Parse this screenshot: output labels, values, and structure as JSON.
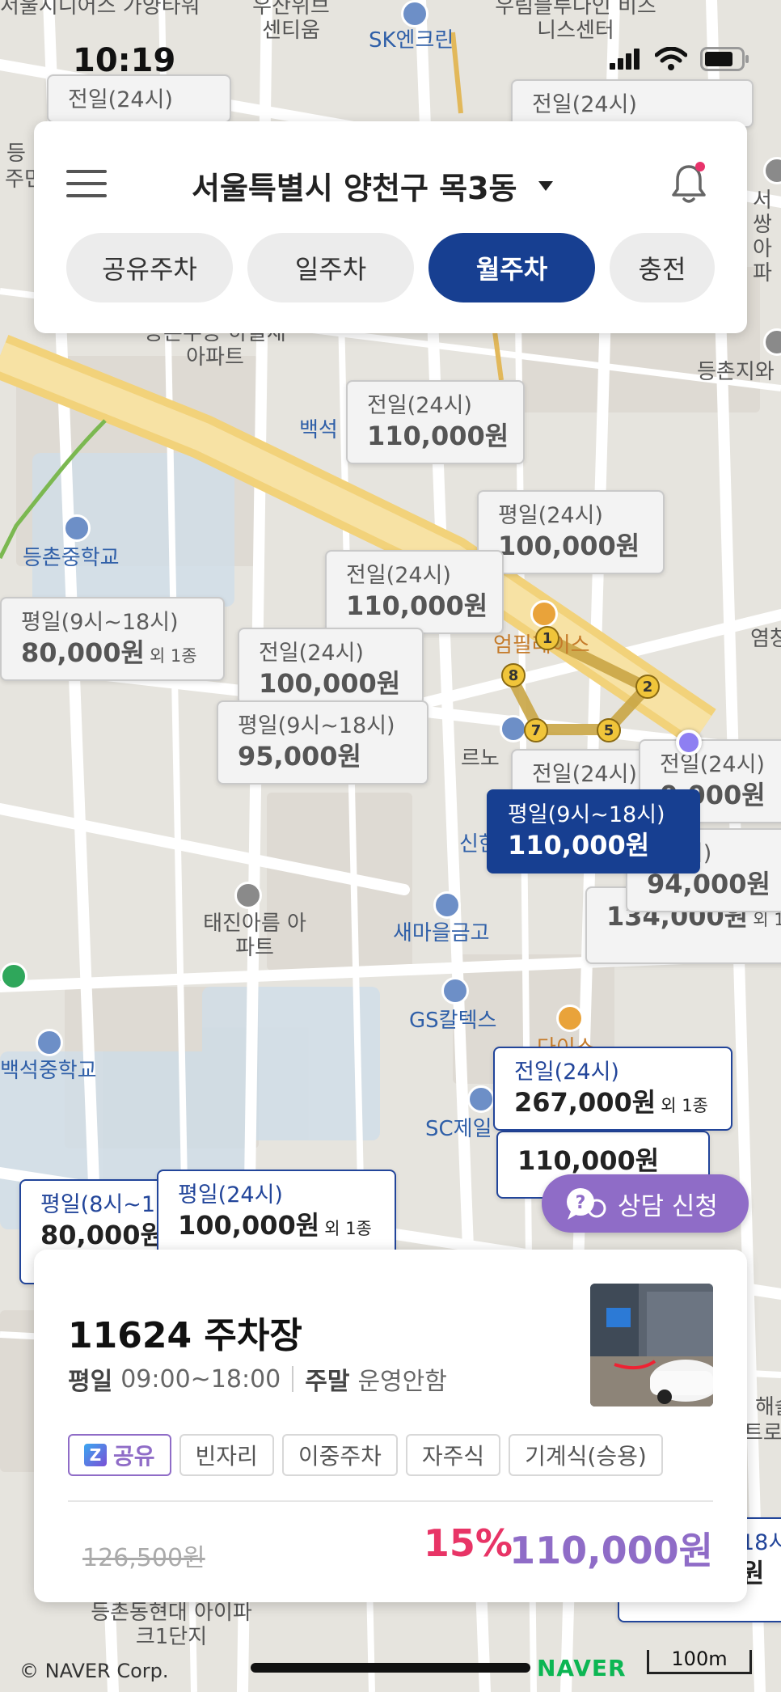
{
  "status_bar": {
    "time": "10:19"
  },
  "header": {
    "location": "서울특별시 양천구 목3동",
    "tabs": [
      {
        "label": "공유주차",
        "active": false
      },
      {
        "label": "일주차",
        "active": false
      },
      {
        "label": "월주차",
        "active": true
      },
      {
        "label": "충전",
        "active": false
      }
    ]
  },
  "map": {
    "pois": [
      "서울시니어스 가양타워",
      "우산위브 센티움",
      "SK엔크린",
      "우림블루나인 비즈니스센터",
      "등촌중학교",
      "등촌주공 하늘채아파트",
      "백석",
      "등촌지와",
      "엄필레이스",
      "르노",
      "신한",
      "태진아름 아파트",
      "새마을금고",
      "GS칼텍스",
      "다이소",
      "백석중학교",
      "SC제일",
      "등촌동현대 아이파크1단지",
      "염창",
      "서쌍 아파",
      "등",
      "주민",
      "해솔",
      "트로"
    ],
    "markers": [
      {
        "type": "전일(24시)",
        "price": ""
      },
      {
        "type": "전일(24시)",
        "price": ""
      },
      {
        "type": "전일(24시)",
        "price": "110,000원"
      },
      {
        "type": "평일(24시)",
        "price": "100,000원"
      },
      {
        "type": "전일(24시)",
        "price": "110,000원"
      },
      {
        "type": "평일(9시~18시)",
        "price": "80,000원",
        "extra": "외 1종"
      },
      {
        "type": "전일(24시)",
        "price": "100,000원"
      },
      {
        "type": "평일(9시~18시)",
        "price": "95,000원"
      },
      {
        "type": "전일(24시)",
        "price": ""
      },
      {
        "type": "전일(24시)",
        "price": "0,000원"
      },
      {
        "type": "(24시)",
        "price": "94,000원"
      },
      {
        "type": "",
        "price": "134,000원",
        "extra": "외 1"
      },
      {
        "type": "평일(9시~18시)",
        "price": "110,000원"
      },
      {
        "type": "전일(24시)",
        "price": "267,000원",
        "extra": "외 1종"
      },
      {
        "type": "",
        "price": "110,000원"
      },
      {
        "type": "평일(8시~1",
        "price": "80,000원"
      },
      {
        "type": "평일(24시)",
        "price": "100,000원",
        "extra": "외 1종"
      },
      {
        "type": "18시",
        "price": "원"
      }
    ]
  },
  "consult_button": {
    "label": "상담 신청"
  },
  "detail": {
    "name": "11624 주차장",
    "weekday_label": "평일",
    "weekday_hours": "09:00~18:00",
    "weekend_label": "주말",
    "weekend_hours": "운영안함",
    "tags": [
      "공유",
      "빈자리",
      "이중주차",
      "자주식",
      "기계식(승용)"
    ],
    "original_price": "126,500원",
    "discount": "15%",
    "final_price": "110,000원"
  },
  "footer": {
    "copyright": "© NAVER Corp.",
    "brand": "NAVER",
    "scale": "100m"
  },
  "colors": {
    "primary": "#173f91",
    "accent": "#8f6cc7",
    "discount": "#e83466"
  }
}
